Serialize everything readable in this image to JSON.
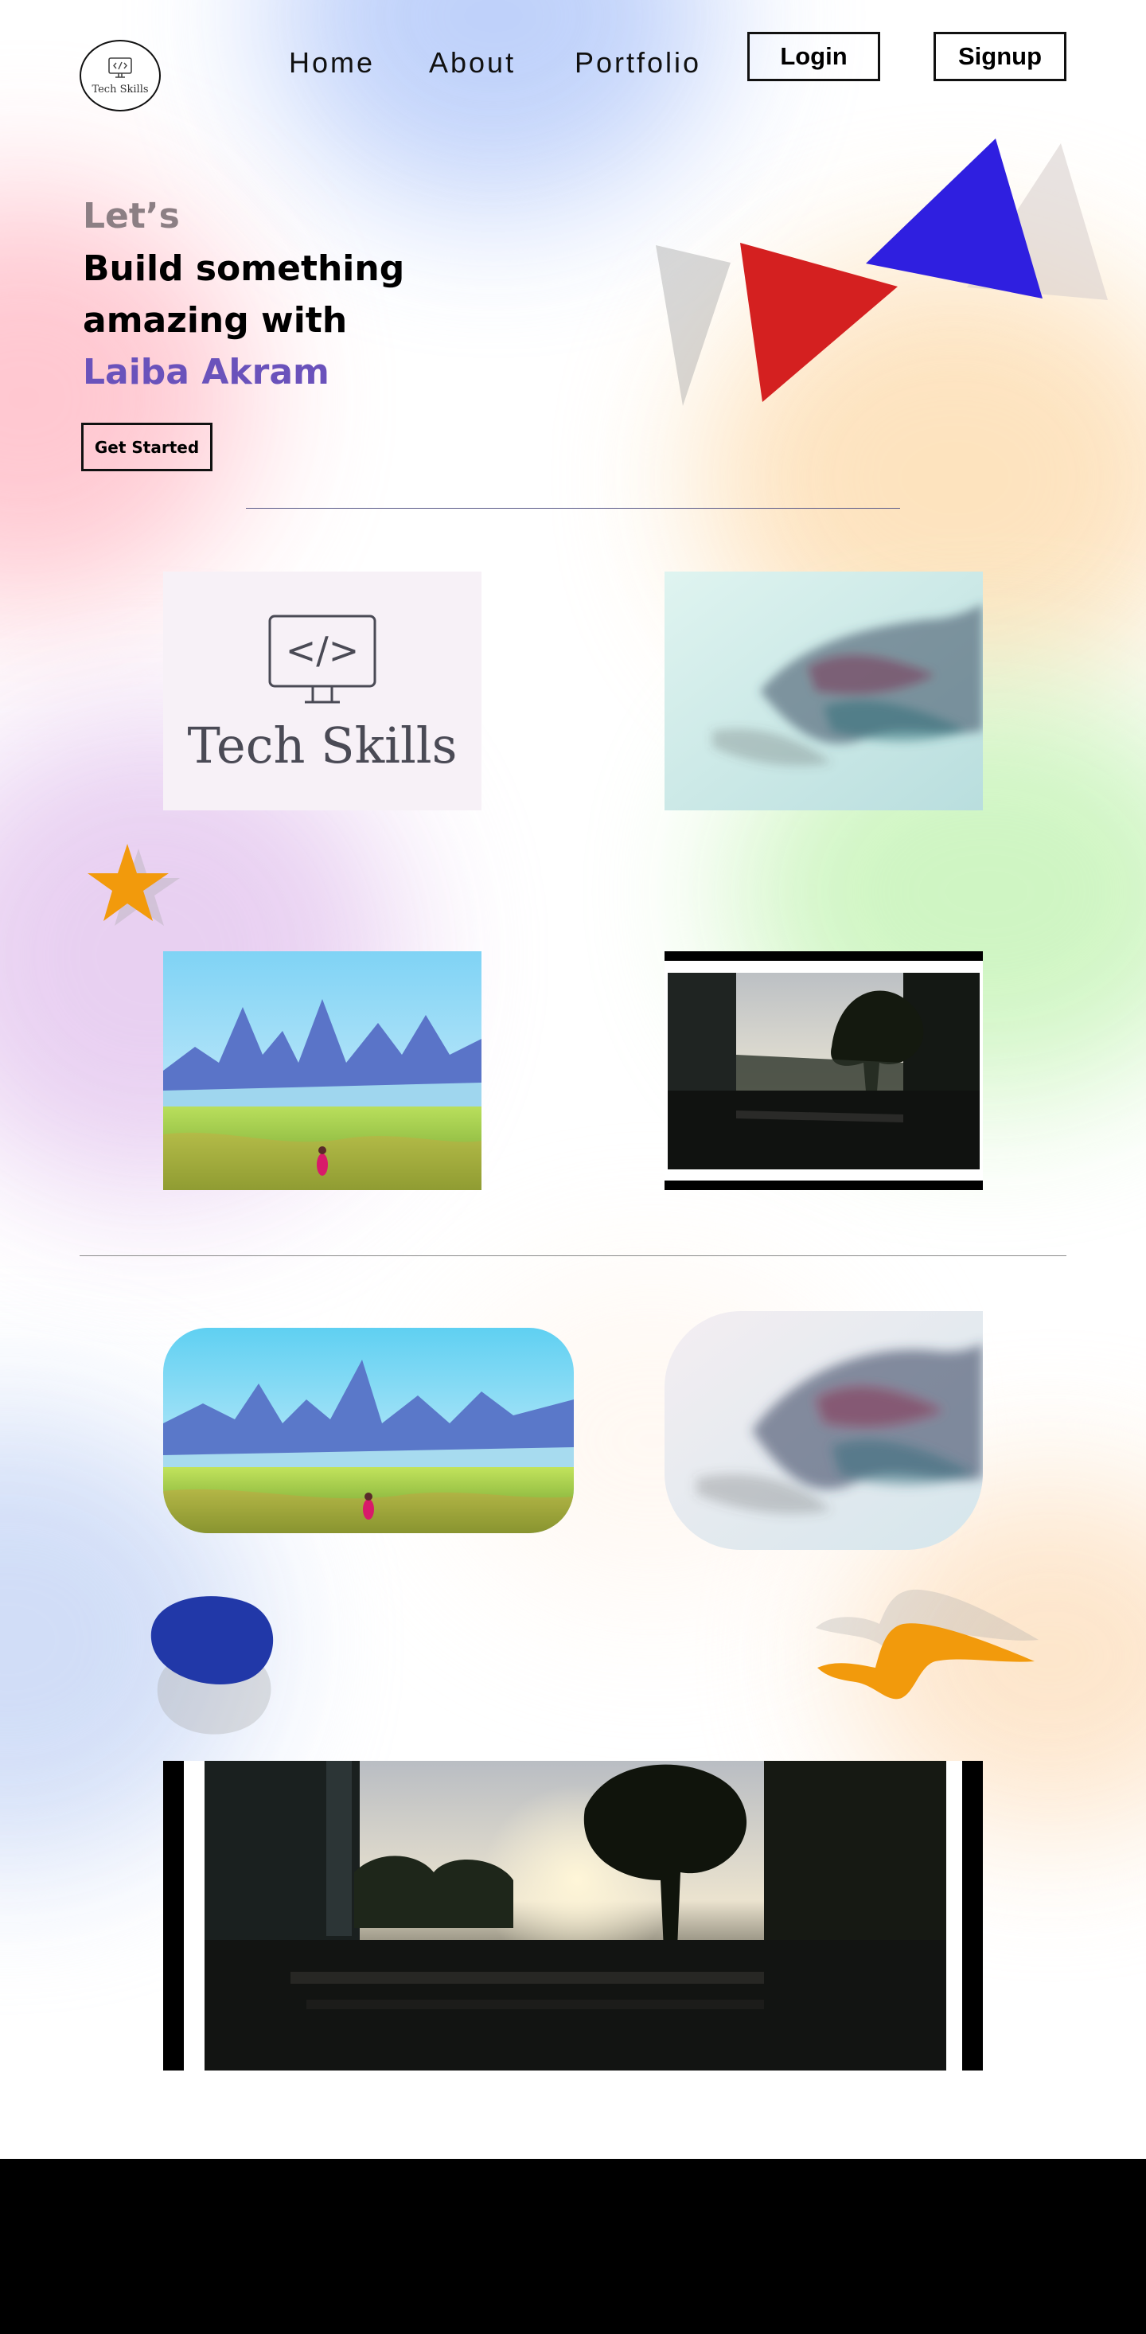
{
  "brand": {
    "logo_text": "Tech Skills",
    "logo_icon": "monitor-code-icon"
  },
  "nav": {
    "links": [
      "Home",
      "About",
      "Portfolio"
    ],
    "login_label": "Login",
    "signup_label": "Signup"
  },
  "hero": {
    "line1": "Let’s",
    "line2": "Build something",
    "line3": "amazing with",
    "name": "Laiba Akram",
    "cta_label": "Get Started"
  },
  "gallery": {
    "tech_tile": {
      "code_symbol": "</>",
      "title": "Tech Skills"
    }
  },
  "colors": {
    "accent_purple": "#6a52bb",
    "muted_heading": "#8c7f84",
    "triangle_red": "#d42020",
    "triangle_blue": "#2f1fe0",
    "star_orange": "#f29a0c",
    "blob_blue": "#2138a8",
    "footer": "#000000"
  },
  "decor": [
    "red-triangle",
    "blue-triangle",
    "orange-star",
    "blue-blob",
    "orange-squiggle"
  ]
}
